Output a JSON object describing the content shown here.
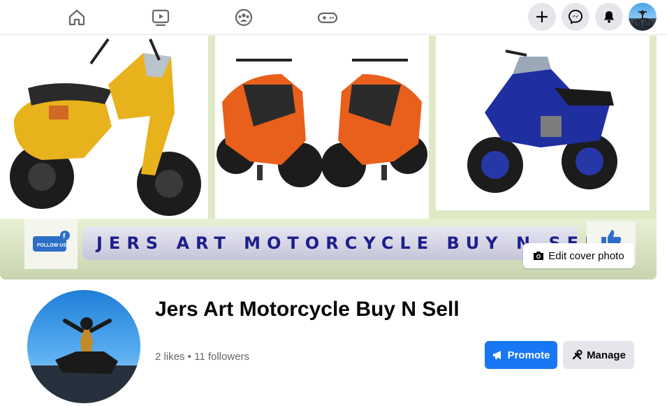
{
  "nav": {
    "icons": [
      "home-icon",
      "watch-icon",
      "groups-icon",
      "gaming-icon"
    ],
    "right": [
      "create-icon",
      "messenger-icon",
      "notifications-icon",
      "account-avatar"
    ]
  },
  "cover": {
    "banner_text": "JERS ART MOTORCYCLE BUY N SELL",
    "follow_badge": "FOLLOW US",
    "edit_cover_label": "Edit cover photo"
  },
  "profile": {
    "name": "Jers Art Motorcycle Buy N Sell",
    "subtext": "2 likes • 11 followers"
  },
  "actions": {
    "promote_label": "Promote",
    "manage_label": "Manage"
  },
  "colors": {
    "brand": "#1877f2",
    "banner_text": "#1e1e8c",
    "cover_frame": "#dfe9c6"
  }
}
